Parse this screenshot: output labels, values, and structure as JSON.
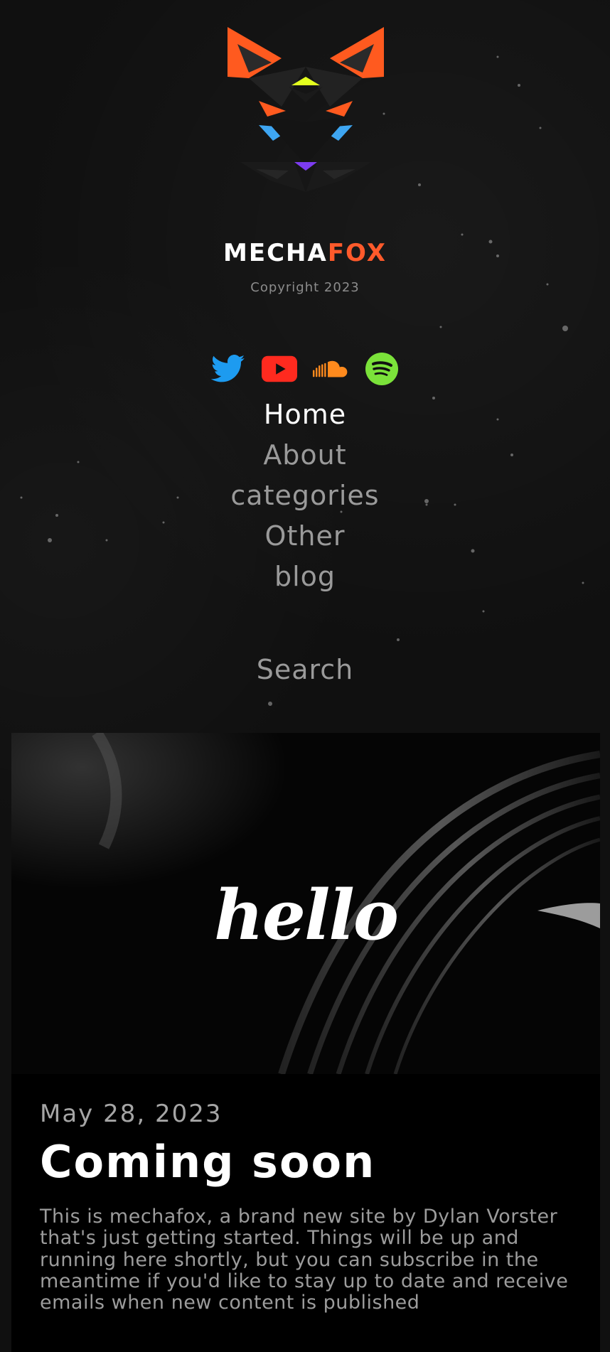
{
  "brand": {
    "wordmark_part1": "MECHA",
    "wordmark_part2": "FOX",
    "copyright": "Copyright 2023"
  },
  "socials": [
    {
      "name": "twitter-icon",
      "color": "#1d9bf0"
    },
    {
      "name": "youtube-icon",
      "color": "#ff2a1f"
    },
    {
      "name": "soundcloud-icon",
      "color": "#ff8a1d"
    },
    {
      "name": "spotify-icon",
      "color": "#7be23a"
    }
  ],
  "nav": {
    "items": [
      {
        "label": "Home",
        "active": true
      },
      {
        "label": "About",
        "active": false
      },
      {
        "label": "categories",
        "active": false
      },
      {
        "label": "Other",
        "active": false
      },
      {
        "label": "blog",
        "active": false
      }
    ],
    "search_label": "Search"
  },
  "post": {
    "hero_text": "hello",
    "date": "May 28, 2023",
    "title": "Coming soon",
    "excerpt": "This is mechafox, a brand new site by Dylan Vorster that's just getting started. Things will be up and running here shortly, but you can subscribe in the meantime if you'd like to stay up to date and receive emails when new content is published"
  },
  "colors": {
    "background": "#101010",
    "accent_orange": "#ff5a2b",
    "nav_muted": "#9a9a9a"
  }
}
